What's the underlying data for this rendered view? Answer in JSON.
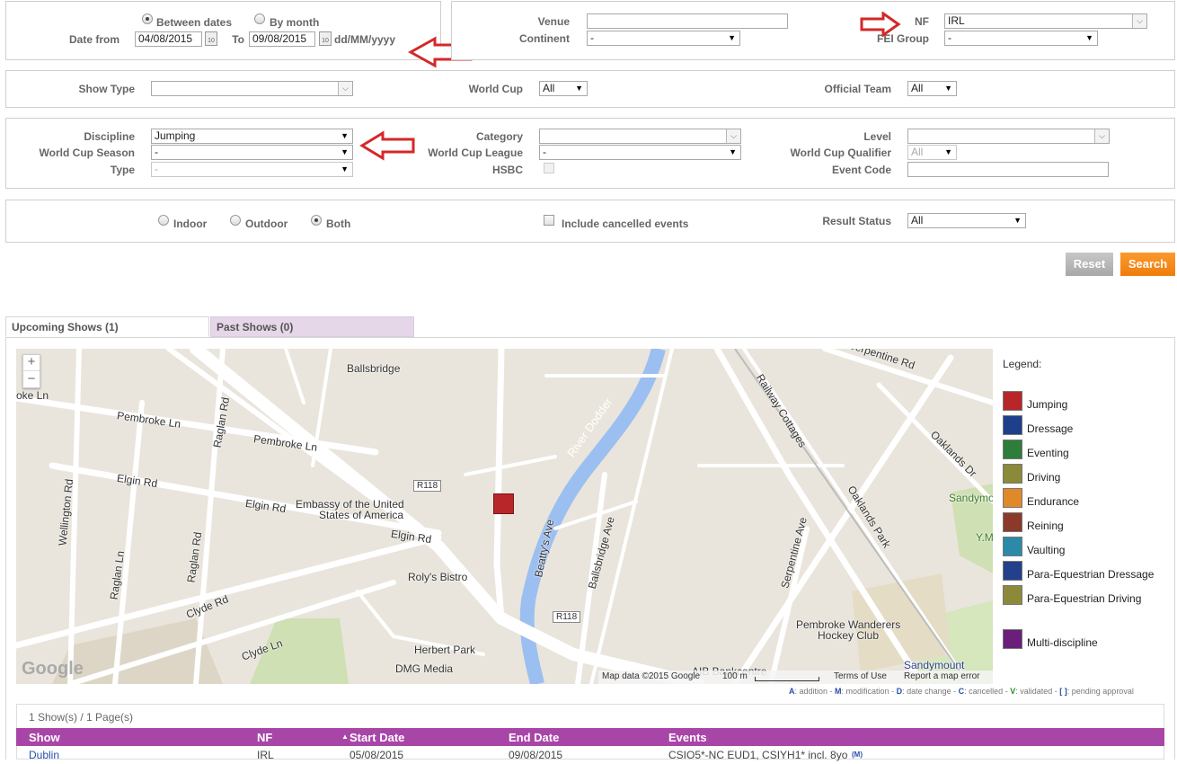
{
  "date_panel": {
    "radio_between": "Between dates",
    "radio_month": "By month",
    "date_from_label": "Date from",
    "date_from_value": "04/08/2015",
    "to_label": "To",
    "to_value": "09/08/2015",
    "format_hint": "dd/MM/yyyy",
    "cal_icon_text": "10"
  },
  "venue_panel": {
    "venue_label": "Venue",
    "venue_value": "",
    "continent_label": "Continent",
    "continent_value": "-",
    "nf_label": "NF",
    "nf_value": "IRL",
    "fei_group_label": "FEI Group",
    "fei_group_value": "-"
  },
  "row2": {
    "show_type_label": "Show Type",
    "show_type_value": "",
    "world_cup_label": "World Cup",
    "world_cup_value": "All",
    "official_team_label": "Official Team",
    "official_team_value": "All"
  },
  "row3": {
    "discipline_label": "Discipline",
    "discipline_value": "Jumping",
    "wc_season_label": "World Cup Season",
    "wc_season_value": "-",
    "type_label": "Type",
    "type_value": "-",
    "category_label": "Category",
    "category_value": "",
    "wc_league_label": "World Cup League",
    "wc_league_value": "-",
    "hsbc_label": "HSBC",
    "level_label": "Level",
    "level_value": "",
    "wc_qualifier_label": "World Cup Qualifier",
    "wc_qualifier_value": "All",
    "event_code_label": "Event Code",
    "event_code_value": ""
  },
  "row4": {
    "indoor": "Indoor",
    "outdoor": "Outdoor",
    "both": "Both",
    "include_cancelled": "Include cancelled events",
    "result_status_label": "Result Status",
    "result_status_value": "All"
  },
  "buttons": {
    "reset": "Reset",
    "search": "Search"
  },
  "tabs": {
    "upcoming": "Upcoming Shows (1)",
    "past": "Past Shows (0)"
  },
  "map": {
    "zoom_in": "+",
    "zoom_out": "−",
    "labels": {
      "ballsbridge": "Ballsbridge",
      "pembroke_ln_1": "Pembroke Ln",
      "pembroke_ln_2": "Pembroke Ln",
      "raglan_rd_1": "Raglan Rd",
      "raglan_rd_2": "Raglan Rd",
      "raglan_ln": "Raglan Ln",
      "elgin_rd_1": "Elgin Rd",
      "elgin_rd_2": "Elgin Rd",
      "elgin_rd_3": "Elgin Rd",
      "wellington_rd": "Wellington Rd",
      "embassy_1": "Embassy of the United",
      "embassy_2": "States of America",
      "clyde_rd": "Clyde Rd",
      "clyde_ln": "Clyde Ln",
      "rolys": "Roly's Bistro",
      "herbert_park": "Herbert Park",
      "dmg": "DMG Media",
      "r118_1": "R118",
      "r118_2": "R118",
      "river": "River Dodder",
      "beattys": "Beatty's Ave",
      "ballsbridge_ave": "Ballsbridge Ave",
      "railway": "Railway Cottages",
      "oaklands_park": "Oaklands Park",
      "oaklands_dr": "Oaklands Dr",
      "serpentine_ave": "Serpentine Ave",
      "serpentine_rd": "Serpentine Rd",
      "pembroke_w_1": "Pembroke Wanderers",
      "pembroke_w_2": "Hockey Club",
      "sandymount_1": "Sandymount",
      "sandymount_2": "Sandymount",
      "aib": "AIB Bankcentre",
      "oke_ln": "oke Ln",
      "ym": "Y.M"
    },
    "google": "Google",
    "map_data": "Map data ©2015 Google",
    "scale": "100 m",
    "terms": "Terms of Use",
    "report": "Report a map error"
  },
  "legend": {
    "title": "Legend:",
    "items": [
      {
        "label": "Jumping",
        "color": "#b8262a"
      },
      {
        "label": "Dressage",
        "color": "#1f3f8c"
      },
      {
        "label": "Eventing",
        "color": "#2f7d3a"
      },
      {
        "label": "Driving",
        "color": "#8a8a3a"
      },
      {
        "label": "Endurance",
        "color": "#e0892b"
      },
      {
        "label": "Reining",
        "color": "#8b3a2a"
      },
      {
        "label": "Vaulting",
        "color": "#2c8aa8"
      },
      {
        "label": "Para-Equestrian Dressage",
        "color": "#23418a"
      },
      {
        "label": "Para-Equestrian Driving",
        "color": "#8c8a3a"
      },
      {
        "label": "Multi-discipline",
        "color": "#6a1f7a"
      }
    ]
  },
  "status_legend": {
    "a_key": "A",
    "a_text": ": addition -",
    "m_key": "M",
    "m_text": ": modification -",
    "d_key": "D",
    "d_text": ": date change -",
    "c_key": "C",
    "c_text": ": cancelled -",
    "v_key": "V",
    "v_text": ": validated -",
    "p_key": "[ ]",
    "p_text": ": pending approval"
  },
  "results": {
    "summary": "1 Show(s) / 1 Page(s)",
    "columns": [
      "Show",
      "NF",
      "Start Date",
      "End Date",
      "Events"
    ],
    "rows": [
      {
        "show": "Dublin",
        "nf": "IRL",
        "start": "05/08/2015",
        "end": "09/08/2015",
        "events": "CSIO5*-NC EUD1, CSIYH1* incl. 8yo",
        "badge": "(M)"
      }
    ]
  }
}
